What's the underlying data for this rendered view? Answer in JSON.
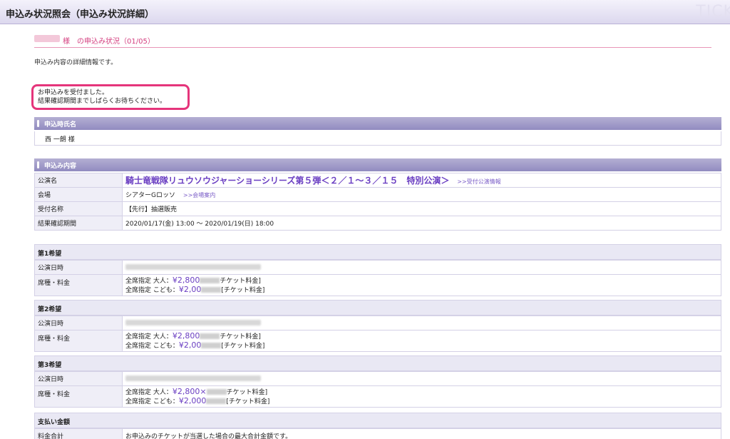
{
  "header": {
    "title": "申込み状況照会（申込み状況詳細）",
    "watermark": "TICK"
  },
  "subheader": {
    "suffix": "様　の申込み状況（01/05）"
  },
  "intro": "申込み内容の詳細情報です。",
  "notice": {
    "line1": "お申込みを受付ました。",
    "line2": "結果確認期間までしばらくお待ちください。"
  },
  "applicant": {
    "heading": "申込時氏名",
    "name": "西 一朗 様"
  },
  "details": {
    "heading": "申込み内容",
    "performance_label": "公演名",
    "performance_title": "騎士竜戦隊リュウソウジャーショーシリーズ第５弾＜２／１～３／１５　特別公演＞",
    "performance_link": ">>受付公演情報",
    "venue_label": "会場",
    "venue": "シアターGロッソ",
    "venue_link": ">>会場案内",
    "reception_label": "受付名称",
    "reception": "【先行】抽選販売",
    "period_label": "結果確認期間",
    "period": "2020/01/17(金) 13:00 ～ 2020/01/19(日) 18:00"
  },
  "choices": [
    {
      "heading": "第1希望",
      "date_label": "公演日時",
      "seat_label": "席種・料金",
      "adult_prefix": "全席指定 大人：",
      "adult_price": "¥2,800",
      "adult_suffix": "チケット料金]",
      "child_prefix": "全席指定 こども：",
      "child_price": "¥2,00",
      "child_suffix": "[チケット料金]"
    },
    {
      "heading": "第2希望",
      "date_label": "公演日時",
      "seat_label": "席種・料金",
      "adult_prefix": "全席指定 大人：",
      "adult_price": "¥2,800",
      "adult_suffix": "チケット料金]",
      "child_prefix": "全席指定 こども：",
      "child_price": "¥2,00",
      "child_suffix": "[チケット料金]"
    },
    {
      "heading": "第3希望",
      "date_label": "公演日時",
      "seat_label": "席種・料金",
      "adult_prefix": "全席指定 大人：",
      "adult_price": "¥2,800×",
      "adult_suffix": "チケット料金]",
      "child_prefix": "全席指定 こども：",
      "child_price": "¥2,000",
      "child_suffix": "[チケット料金]"
    }
  ],
  "payment": {
    "heading": "支払い金額",
    "total_label": "料金合計",
    "total_note": "お申込みのチケットが当選した場合の最大合計金額です。"
  }
}
